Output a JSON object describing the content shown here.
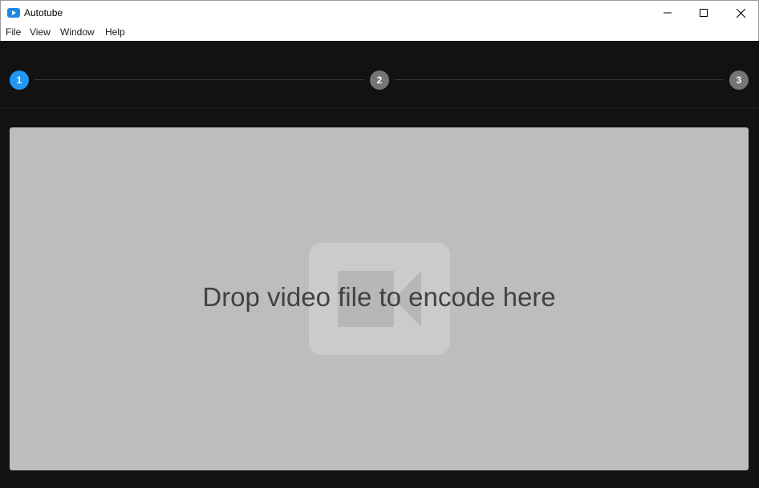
{
  "window": {
    "title": "Autotube",
    "icon": "play-icon",
    "controls": [
      "minimize-icon",
      "maximize-icon",
      "close-icon"
    ]
  },
  "menu": {
    "items": [
      "File",
      "View",
      "Window",
      "Help"
    ]
  },
  "stepper": {
    "steps": [
      {
        "label": "1",
        "state": "active"
      },
      {
        "label": "2",
        "state": "inactive"
      },
      {
        "label": "3",
        "state": "inactive"
      }
    ],
    "active_color": "#2196f3",
    "inactive_color": "#757575"
  },
  "dropzone": {
    "text": "Drop video file to encode here",
    "icon": "video-camera-icon"
  }
}
